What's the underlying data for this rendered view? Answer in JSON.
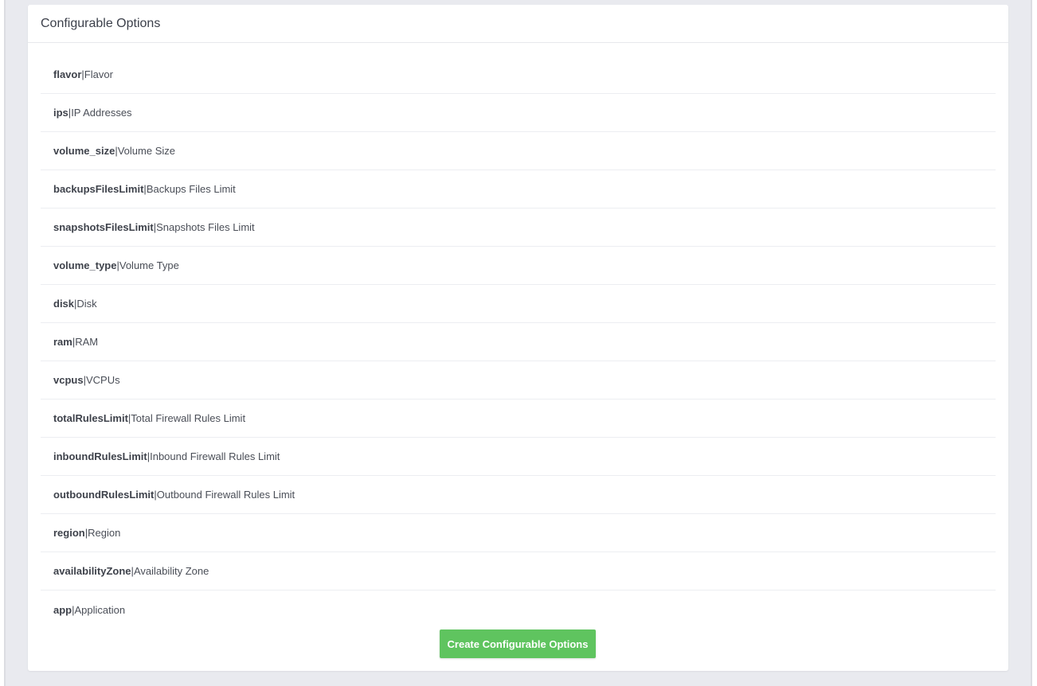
{
  "panel": {
    "title": "Configurable Options"
  },
  "options": [
    {
      "key": "flavor",
      "label": "Flavor"
    },
    {
      "key": "ips",
      "label": "IP Addresses"
    },
    {
      "key": "volume_size",
      "label": "Volume Size"
    },
    {
      "key": "backupsFilesLimit",
      "label": "Backups Files Limit"
    },
    {
      "key": "snapshotsFilesLimit",
      "label": "Snapshots Files Limit"
    },
    {
      "key": "volume_type",
      "label": "Volume Type"
    },
    {
      "key": "disk",
      "label": "Disk"
    },
    {
      "key": "ram",
      "label": "RAM"
    },
    {
      "key": "vcpus",
      "label": "VCPUs"
    },
    {
      "key": "totalRulesLimit",
      "label": "Total Firewall Rules Limit"
    },
    {
      "key": "inboundRulesLimit",
      "label": "Inbound Firewall Rules Limit"
    },
    {
      "key": "outboundRulesLimit",
      "label": "Outbound Firewall Rules Limit"
    },
    {
      "key": "region",
      "label": "Region"
    },
    {
      "key": "availabilityZone",
      "label": "Availability Zone"
    },
    {
      "key": "app",
      "label": "Application"
    }
  ],
  "separator": "|",
  "actions": {
    "create_label": "Create Configurable Options"
  },
  "colors": {
    "primary_button": "#5fc45f",
    "background": "#e9eaef"
  }
}
